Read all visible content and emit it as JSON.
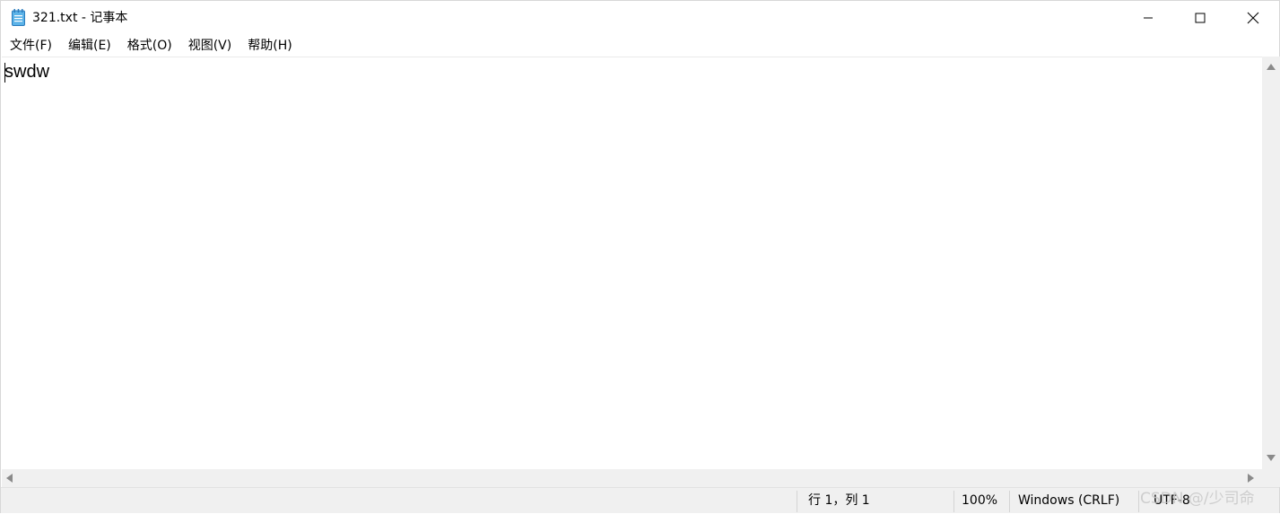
{
  "window": {
    "title": "321.txt - 记事本",
    "app_icon": "notepad-icon",
    "controls": {
      "minimize_icon": "minimize-icon",
      "maximize_icon": "maximize-icon",
      "close_icon": "close-icon"
    }
  },
  "menu": {
    "items": [
      {
        "label": "文件(F)"
      },
      {
        "label": "编辑(E)"
      },
      {
        "label": "格式(O)"
      },
      {
        "label": "视图(V)"
      },
      {
        "label": "帮助(H)"
      }
    ]
  },
  "editor": {
    "content": "swdw"
  },
  "status": {
    "position": "行 1，列 1",
    "zoom": "100%",
    "line_ending": "Windows (CRLF)",
    "encoding": "UTF-8"
  },
  "watermark": "CSDN @/少司命",
  "colors": {
    "chrome": "#f0f0f0",
    "text": "#000000",
    "icon": "#4a9fd8"
  }
}
